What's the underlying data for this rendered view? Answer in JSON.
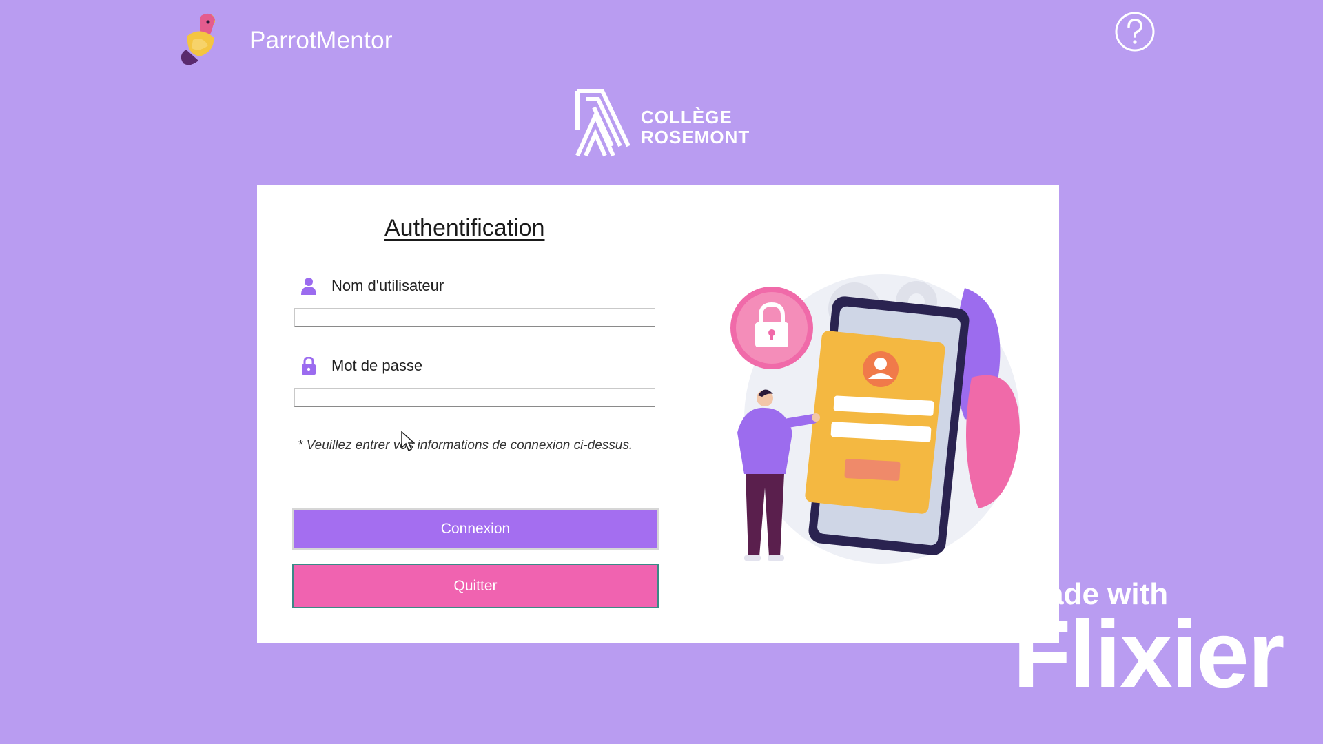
{
  "header": {
    "app_name": "ParrotMentor",
    "help_icon": "help-circle-icon",
    "app_logo_icon": "parrot-logo-icon"
  },
  "institution": {
    "line1": "COLLÈGE",
    "line2": "ROSEMONT"
  },
  "login": {
    "title": "Authentification",
    "username_label": "Nom d'utilisateur",
    "username_value": "",
    "username_icon": "user-icon",
    "password_label": "Mot de passe",
    "password_value": "",
    "password_icon": "lock-icon",
    "hint": "* Veuillez entrer vos informations de connexion ci-dessus.",
    "login_button": "Connexion",
    "quit_button": "Quitter"
  },
  "watermark": {
    "line1": "made with",
    "line2": "Flixier"
  },
  "colors": {
    "background": "#b99cf1",
    "primary_button": "#a46ef0",
    "quit_button": "#f063b0",
    "icon_accent": "#9b6bef"
  }
}
